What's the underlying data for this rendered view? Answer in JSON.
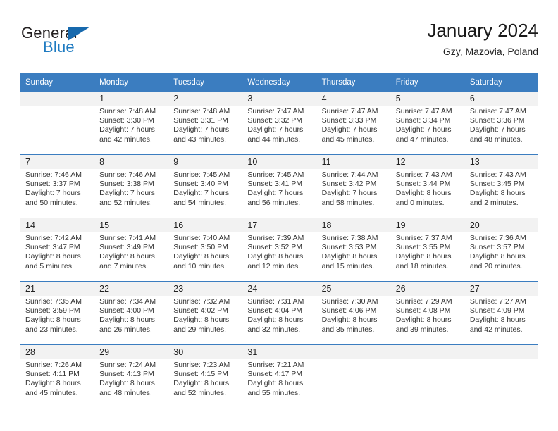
{
  "brand": {
    "word1": "General",
    "word2": "Blue",
    "flag_icon": "triangle-flag-icon",
    "accent_color": "#1769ad"
  },
  "header": {
    "title": "January 2024",
    "subtitle": "Gzy, Mazovia, Poland"
  },
  "theme": {
    "header_bg": "#3b7dc0",
    "daynum_bg": "#f2f2f2",
    "text": "#333333"
  },
  "columns": [
    "Sunday",
    "Monday",
    "Tuesday",
    "Wednesday",
    "Thursday",
    "Friday",
    "Saturday"
  ],
  "weeks": [
    {
      "days": [
        {
          "num": "",
          "sunrise": "",
          "sunset": "",
          "daylight1": "",
          "daylight2": ""
        },
        {
          "num": "1",
          "sunrise": "Sunrise: 7:48 AM",
          "sunset": "Sunset: 3:30 PM",
          "daylight1": "Daylight: 7 hours",
          "daylight2": "and 42 minutes."
        },
        {
          "num": "2",
          "sunrise": "Sunrise: 7:48 AM",
          "sunset": "Sunset: 3:31 PM",
          "daylight1": "Daylight: 7 hours",
          "daylight2": "and 43 minutes."
        },
        {
          "num": "3",
          "sunrise": "Sunrise: 7:47 AM",
          "sunset": "Sunset: 3:32 PM",
          "daylight1": "Daylight: 7 hours",
          "daylight2": "and 44 minutes."
        },
        {
          "num": "4",
          "sunrise": "Sunrise: 7:47 AM",
          "sunset": "Sunset: 3:33 PM",
          "daylight1": "Daylight: 7 hours",
          "daylight2": "and 45 minutes."
        },
        {
          "num": "5",
          "sunrise": "Sunrise: 7:47 AM",
          "sunset": "Sunset: 3:34 PM",
          "daylight1": "Daylight: 7 hours",
          "daylight2": "and 47 minutes."
        },
        {
          "num": "6",
          "sunrise": "Sunrise: 7:47 AM",
          "sunset": "Sunset: 3:36 PM",
          "daylight1": "Daylight: 7 hours",
          "daylight2": "and 48 minutes."
        }
      ]
    },
    {
      "days": [
        {
          "num": "7",
          "sunrise": "Sunrise: 7:46 AM",
          "sunset": "Sunset: 3:37 PM",
          "daylight1": "Daylight: 7 hours",
          "daylight2": "and 50 minutes."
        },
        {
          "num": "8",
          "sunrise": "Sunrise: 7:46 AM",
          "sunset": "Sunset: 3:38 PM",
          "daylight1": "Daylight: 7 hours",
          "daylight2": "and 52 minutes."
        },
        {
          "num": "9",
          "sunrise": "Sunrise: 7:45 AM",
          "sunset": "Sunset: 3:40 PM",
          "daylight1": "Daylight: 7 hours",
          "daylight2": "and 54 minutes."
        },
        {
          "num": "10",
          "sunrise": "Sunrise: 7:45 AM",
          "sunset": "Sunset: 3:41 PM",
          "daylight1": "Daylight: 7 hours",
          "daylight2": "and 56 minutes."
        },
        {
          "num": "11",
          "sunrise": "Sunrise: 7:44 AM",
          "sunset": "Sunset: 3:42 PM",
          "daylight1": "Daylight: 7 hours",
          "daylight2": "and 58 minutes."
        },
        {
          "num": "12",
          "sunrise": "Sunrise: 7:43 AM",
          "sunset": "Sunset: 3:44 PM",
          "daylight1": "Daylight: 8 hours",
          "daylight2": "and 0 minutes."
        },
        {
          "num": "13",
          "sunrise": "Sunrise: 7:43 AM",
          "sunset": "Sunset: 3:45 PM",
          "daylight1": "Daylight: 8 hours",
          "daylight2": "and 2 minutes."
        }
      ]
    },
    {
      "days": [
        {
          "num": "14",
          "sunrise": "Sunrise: 7:42 AM",
          "sunset": "Sunset: 3:47 PM",
          "daylight1": "Daylight: 8 hours",
          "daylight2": "and 5 minutes."
        },
        {
          "num": "15",
          "sunrise": "Sunrise: 7:41 AM",
          "sunset": "Sunset: 3:49 PM",
          "daylight1": "Daylight: 8 hours",
          "daylight2": "and 7 minutes."
        },
        {
          "num": "16",
          "sunrise": "Sunrise: 7:40 AM",
          "sunset": "Sunset: 3:50 PM",
          "daylight1": "Daylight: 8 hours",
          "daylight2": "and 10 minutes."
        },
        {
          "num": "17",
          "sunrise": "Sunrise: 7:39 AM",
          "sunset": "Sunset: 3:52 PM",
          "daylight1": "Daylight: 8 hours",
          "daylight2": "and 12 minutes."
        },
        {
          "num": "18",
          "sunrise": "Sunrise: 7:38 AM",
          "sunset": "Sunset: 3:53 PM",
          "daylight1": "Daylight: 8 hours",
          "daylight2": "and 15 minutes."
        },
        {
          "num": "19",
          "sunrise": "Sunrise: 7:37 AM",
          "sunset": "Sunset: 3:55 PM",
          "daylight1": "Daylight: 8 hours",
          "daylight2": "and 18 minutes."
        },
        {
          "num": "20",
          "sunrise": "Sunrise: 7:36 AM",
          "sunset": "Sunset: 3:57 PM",
          "daylight1": "Daylight: 8 hours",
          "daylight2": "and 20 minutes."
        }
      ]
    },
    {
      "days": [
        {
          "num": "21",
          "sunrise": "Sunrise: 7:35 AM",
          "sunset": "Sunset: 3:59 PM",
          "daylight1": "Daylight: 8 hours",
          "daylight2": "and 23 minutes."
        },
        {
          "num": "22",
          "sunrise": "Sunrise: 7:34 AM",
          "sunset": "Sunset: 4:00 PM",
          "daylight1": "Daylight: 8 hours",
          "daylight2": "and 26 minutes."
        },
        {
          "num": "23",
          "sunrise": "Sunrise: 7:32 AM",
          "sunset": "Sunset: 4:02 PM",
          "daylight1": "Daylight: 8 hours",
          "daylight2": "and 29 minutes."
        },
        {
          "num": "24",
          "sunrise": "Sunrise: 7:31 AM",
          "sunset": "Sunset: 4:04 PM",
          "daylight1": "Daylight: 8 hours",
          "daylight2": "and 32 minutes."
        },
        {
          "num": "25",
          "sunrise": "Sunrise: 7:30 AM",
          "sunset": "Sunset: 4:06 PM",
          "daylight1": "Daylight: 8 hours",
          "daylight2": "and 35 minutes."
        },
        {
          "num": "26",
          "sunrise": "Sunrise: 7:29 AM",
          "sunset": "Sunset: 4:08 PM",
          "daylight1": "Daylight: 8 hours",
          "daylight2": "and 39 minutes."
        },
        {
          "num": "27",
          "sunrise": "Sunrise: 7:27 AM",
          "sunset": "Sunset: 4:09 PM",
          "daylight1": "Daylight: 8 hours",
          "daylight2": "and 42 minutes."
        }
      ]
    },
    {
      "days": [
        {
          "num": "28",
          "sunrise": "Sunrise: 7:26 AM",
          "sunset": "Sunset: 4:11 PM",
          "daylight1": "Daylight: 8 hours",
          "daylight2": "and 45 minutes."
        },
        {
          "num": "29",
          "sunrise": "Sunrise: 7:24 AM",
          "sunset": "Sunset: 4:13 PM",
          "daylight1": "Daylight: 8 hours",
          "daylight2": "and 48 minutes."
        },
        {
          "num": "30",
          "sunrise": "Sunrise: 7:23 AM",
          "sunset": "Sunset: 4:15 PM",
          "daylight1": "Daylight: 8 hours",
          "daylight2": "and 52 minutes."
        },
        {
          "num": "31",
          "sunrise": "Sunrise: 7:21 AM",
          "sunset": "Sunset: 4:17 PM",
          "daylight1": "Daylight: 8 hours",
          "daylight2": "and 55 minutes."
        },
        {
          "num": "",
          "sunrise": "",
          "sunset": "",
          "daylight1": "",
          "daylight2": ""
        },
        {
          "num": "",
          "sunrise": "",
          "sunset": "",
          "daylight1": "",
          "daylight2": ""
        },
        {
          "num": "",
          "sunrise": "",
          "sunset": "",
          "daylight1": "",
          "daylight2": ""
        }
      ]
    }
  ]
}
